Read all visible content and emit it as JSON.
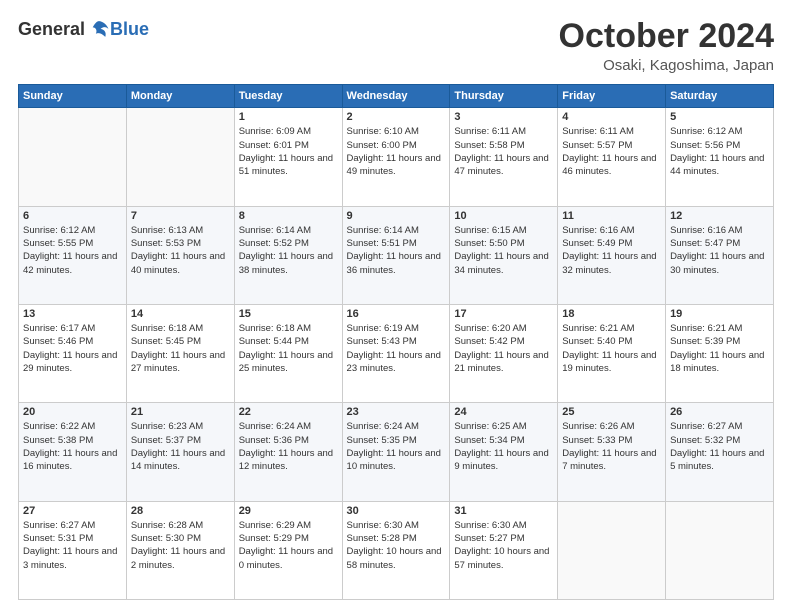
{
  "logo": {
    "general": "General",
    "blue": "Blue"
  },
  "title": "October 2024",
  "location": "Osaki, Kagoshima, Japan",
  "days_of_week": [
    "Sunday",
    "Monday",
    "Tuesday",
    "Wednesday",
    "Thursday",
    "Friday",
    "Saturday"
  ],
  "weeks": [
    [
      {
        "day": "",
        "content": ""
      },
      {
        "day": "",
        "content": ""
      },
      {
        "day": "1",
        "content": "Sunrise: 6:09 AM\nSunset: 6:01 PM\nDaylight: 11 hours and 51 minutes."
      },
      {
        "day": "2",
        "content": "Sunrise: 6:10 AM\nSunset: 6:00 PM\nDaylight: 11 hours and 49 minutes."
      },
      {
        "day": "3",
        "content": "Sunrise: 6:11 AM\nSunset: 5:58 PM\nDaylight: 11 hours and 47 minutes."
      },
      {
        "day": "4",
        "content": "Sunrise: 6:11 AM\nSunset: 5:57 PM\nDaylight: 11 hours and 46 minutes."
      },
      {
        "day": "5",
        "content": "Sunrise: 6:12 AM\nSunset: 5:56 PM\nDaylight: 11 hours and 44 minutes."
      }
    ],
    [
      {
        "day": "6",
        "content": "Sunrise: 6:12 AM\nSunset: 5:55 PM\nDaylight: 11 hours and 42 minutes."
      },
      {
        "day": "7",
        "content": "Sunrise: 6:13 AM\nSunset: 5:53 PM\nDaylight: 11 hours and 40 minutes."
      },
      {
        "day": "8",
        "content": "Sunrise: 6:14 AM\nSunset: 5:52 PM\nDaylight: 11 hours and 38 minutes."
      },
      {
        "day": "9",
        "content": "Sunrise: 6:14 AM\nSunset: 5:51 PM\nDaylight: 11 hours and 36 minutes."
      },
      {
        "day": "10",
        "content": "Sunrise: 6:15 AM\nSunset: 5:50 PM\nDaylight: 11 hours and 34 minutes."
      },
      {
        "day": "11",
        "content": "Sunrise: 6:16 AM\nSunset: 5:49 PM\nDaylight: 11 hours and 32 minutes."
      },
      {
        "day": "12",
        "content": "Sunrise: 6:16 AM\nSunset: 5:47 PM\nDaylight: 11 hours and 30 minutes."
      }
    ],
    [
      {
        "day": "13",
        "content": "Sunrise: 6:17 AM\nSunset: 5:46 PM\nDaylight: 11 hours and 29 minutes."
      },
      {
        "day": "14",
        "content": "Sunrise: 6:18 AM\nSunset: 5:45 PM\nDaylight: 11 hours and 27 minutes."
      },
      {
        "day": "15",
        "content": "Sunrise: 6:18 AM\nSunset: 5:44 PM\nDaylight: 11 hours and 25 minutes."
      },
      {
        "day": "16",
        "content": "Sunrise: 6:19 AM\nSunset: 5:43 PM\nDaylight: 11 hours and 23 minutes."
      },
      {
        "day": "17",
        "content": "Sunrise: 6:20 AM\nSunset: 5:42 PM\nDaylight: 11 hours and 21 minutes."
      },
      {
        "day": "18",
        "content": "Sunrise: 6:21 AM\nSunset: 5:40 PM\nDaylight: 11 hours and 19 minutes."
      },
      {
        "day": "19",
        "content": "Sunrise: 6:21 AM\nSunset: 5:39 PM\nDaylight: 11 hours and 18 minutes."
      }
    ],
    [
      {
        "day": "20",
        "content": "Sunrise: 6:22 AM\nSunset: 5:38 PM\nDaylight: 11 hours and 16 minutes."
      },
      {
        "day": "21",
        "content": "Sunrise: 6:23 AM\nSunset: 5:37 PM\nDaylight: 11 hours and 14 minutes."
      },
      {
        "day": "22",
        "content": "Sunrise: 6:24 AM\nSunset: 5:36 PM\nDaylight: 11 hours and 12 minutes."
      },
      {
        "day": "23",
        "content": "Sunrise: 6:24 AM\nSunset: 5:35 PM\nDaylight: 11 hours and 10 minutes."
      },
      {
        "day": "24",
        "content": "Sunrise: 6:25 AM\nSunset: 5:34 PM\nDaylight: 11 hours and 9 minutes."
      },
      {
        "day": "25",
        "content": "Sunrise: 6:26 AM\nSunset: 5:33 PM\nDaylight: 11 hours and 7 minutes."
      },
      {
        "day": "26",
        "content": "Sunrise: 6:27 AM\nSunset: 5:32 PM\nDaylight: 11 hours and 5 minutes."
      }
    ],
    [
      {
        "day": "27",
        "content": "Sunrise: 6:27 AM\nSunset: 5:31 PM\nDaylight: 11 hours and 3 minutes."
      },
      {
        "day": "28",
        "content": "Sunrise: 6:28 AM\nSunset: 5:30 PM\nDaylight: 11 hours and 2 minutes."
      },
      {
        "day": "29",
        "content": "Sunrise: 6:29 AM\nSunset: 5:29 PM\nDaylight: 11 hours and 0 minutes."
      },
      {
        "day": "30",
        "content": "Sunrise: 6:30 AM\nSunset: 5:28 PM\nDaylight: 10 hours and 58 minutes."
      },
      {
        "day": "31",
        "content": "Sunrise: 6:30 AM\nSunset: 5:27 PM\nDaylight: 10 hours and 57 minutes."
      },
      {
        "day": "",
        "content": ""
      },
      {
        "day": "",
        "content": ""
      }
    ]
  ]
}
